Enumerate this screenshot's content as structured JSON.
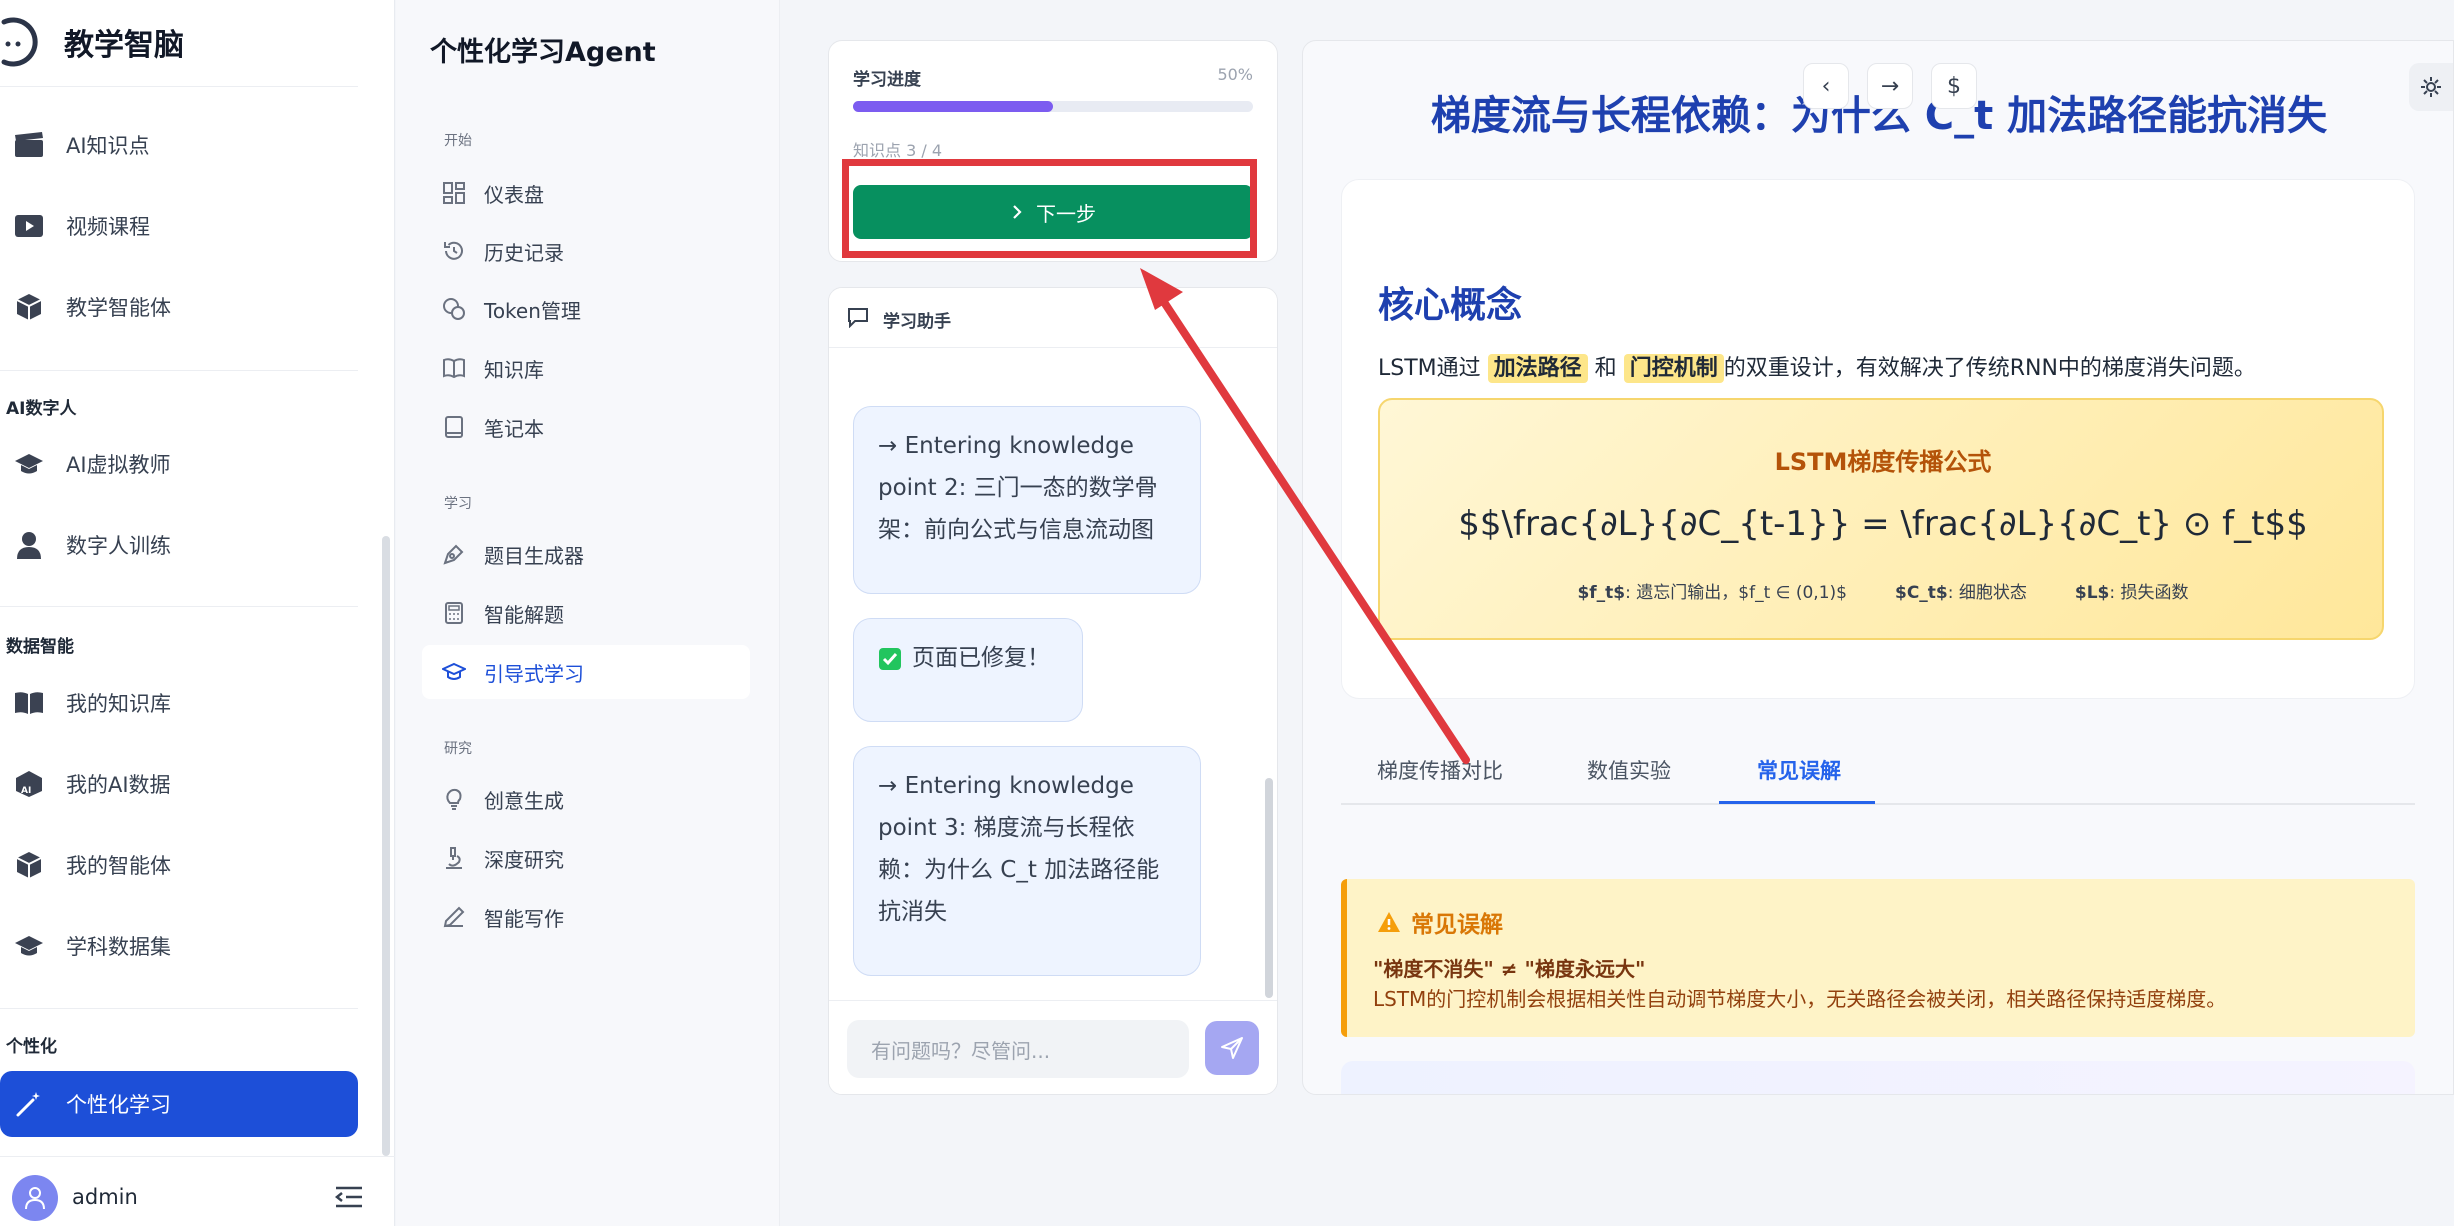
{
  "sidebar": {
    "brand": "教学智脑",
    "items_top": [
      {
        "label": "AI知识点",
        "icon": "clapperboard-icon"
      },
      {
        "label": "视频课程",
        "icon": "video-play-icon"
      },
      {
        "label": "教学智能体",
        "icon": "cube-icon"
      }
    ],
    "section_digital": "AI数字人",
    "items_digital": [
      {
        "label": "AI虚拟教师",
        "icon": "graduation-cap-icon"
      },
      {
        "label": "数字人训练",
        "icon": "person-icon"
      }
    ],
    "section_data": "数据智能",
    "items_data": [
      {
        "label": "我的知识库",
        "icon": "book-open-icon"
      },
      {
        "label": "我的AI数据",
        "icon": "ai-cube-icon"
      },
      {
        "label": "我的智能体",
        "icon": "cube-icon"
      },
      {
        "label": "学科数据集",
        "icon": "graduation-cap-icon"
      }
    ],
    "section_personal": "个性化",
    "active_item": {
      "label": "个性化学习",
      "icon": "magic-wand-icon"
    },
    "user": {
      "name": "admin"
    }
  },
  "subnav": {
    "title": "个性化学习Agent",
    "sections": [
      {
        "title": "开始",
        "items": [
          {
            "label": "仪表盘",
            "icon": "dashboard-icon"
          },
          {
            "label": "历史记录",
            "icon": "history-icon"
          },
          {
            "label": "Token管理",
            "icon": "coins-icon"
          },
          {
            "label": "知识库",
            "icon": "book-icon"
          },
          {
            "label": "笔记本",
            "icon": "notebook-icon"
          }
        ]
      },
      {
        "title": "学习",
        "items": [
          {
            "label": "题目生成器",
            "icon": "pen-tool-icon"
          },
          {
            "label": "智能解题",
            "icon": "calculator-icon"
          },
          {
            "label": "引导式学习",
            "icon": "graduation-cap-icon"
          }
        ]
      },
      {
        "title": "研究",
        "items": [
          {
            "label": "创意生成",
            "icon": "lightbulb-icon"
          },
          {
            "label": "深度研究",
            "icon": "microscope-icon"
          },
          {
            "label": "智能写作",
            "icon": "pencil-icon"
          }
        ]
      }
    ]
  },
  "progress": {
    "label": "学习进度",
    "percent_text": "50%",
    "percent": 50,
    "knowledge_count": "知识点 3 / 4",
    "next_button": "下一步"
  },
  "chat": {
    "title": "学习助手",
    "messages": [
      "→ Entering knowledge point 2: 三门一态的数学骨架：前向公式与信息流动图",
      "页面已修复！",
      "→ Entering knowledge point 3: 梯度流与长程依赖：为什么 C_t 加法路径能抗消失"
    ],
    "input_placeholder": "有问题吗？尽管问..."
  },
  "lesson": {
    "title": "梯度流与长程依赖：为什么 C_t 加法路径能抗消失",
    "nav": {
      "prev": "‹",
      "next": "→",
      "dollar": "$"
    },
    "concept": {
      "title": "核心概念",
      "text_pre": "LSTM通过",
      "highlight1": "加法路径",
      "text_mid": "和",
      "highlight2": "门控机制",
      "text_post": "的双重设计，有效解决了传统RNN中的梯度消失问题。"
    },
    "formula": {
      "title": "LSTM梯度传播公式",
      "latex": "$$\\frac{∂L}{∂C_{t-1}} = \\frac{∂L}{∂C_t} ⊙ f_t$$",
      "legend": [
        {
          "key": "$f_t$",
          "desc": ": 遗忘门输出，$f_t ∈ (0,1)$"
        },
        {
          "key": "$C_t$",
          "desc": ": 细胞状态"
        },
        {
          "key": "$L$",
          "desc": ": 损失函数"
        }
      ]
    },
    "tabs": [
      "梯度传播对比",
      "数值实验",
      "常见误解"
    ],
    "active_tab": "常见误解",
    "warning": {
      "title": "常见误解",
      "line1": "\"梯度不消失\" ≠ \"梯度永远大\"",
      "line2": "LSTM的门控机制会根据相关性自动调节梯度大小，无关路径会被关闭，相关路径保持适度梯度。"
    }
  },
  "colors": {
    "accent": "#1d4fd8",
    "next_button": "#07905f",
    "progress_fill": "#7c5cf0",
    "annotation_red": "#e0393e",
    "title_blue": "#1e40af"
  }
}
